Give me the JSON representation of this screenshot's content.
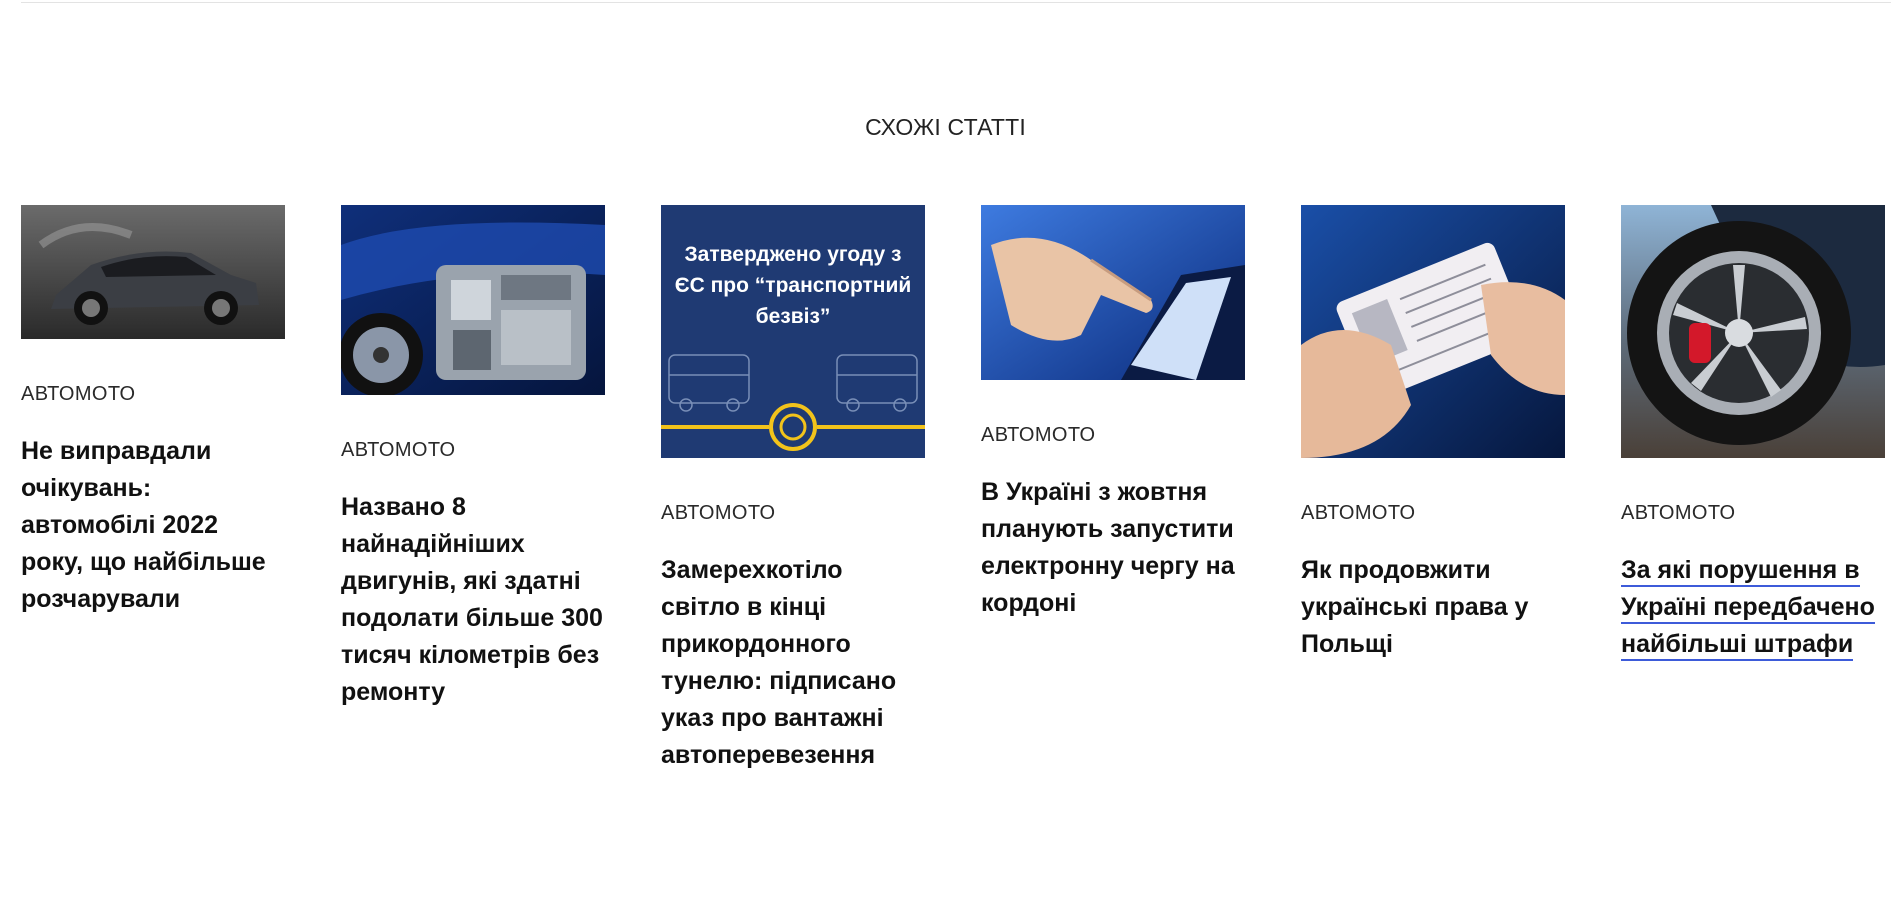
{
  "section": {
    "title": "СХОЖІ СТАТТІ"
  },
  "articles": [
    {
      "category": "АВТОМОТО",
      "title": "Не виправдали очікувань: автомобілі 2022 року, що найбільше розчарували",
      "image_icon": "car-photo-icon"
    },
    {
      "category": "АВТОМОТО",
      "title": "Названо 8 найнадійніших двигунів, які здатні подолати більше 300 тисяч кілометрів без ремонту",
      "image_icon": "engine-photo-icon"
    },
    {
      "category": "АВТОМОТО",
      "title": "Замерехкотіло світло в кінці прикордонного тунелю: підписано указ про вантажні автоперевезення",
      "image_icon": "transport-bezviz-banner-icon",
      "image_text_lines": [
        "Затверджено угоду з",
        "ЄС про “транспортний",
        "безвіз”"
      ]
    },
    {
      "category": "АВТОМОТО",
      "title": "В Україні з жовтня планують запустити електронну чергу на кордоні",
      "image_icon": "hand-tablet-photo-icon"
    },
    {
      "category": "АВТОМОТО",
      "title": "Як продовжити українські права у Польщі",
      "image_icon": "driver-license-photo-icon"
    },
    {
      "category": "АВТОМОТО",
      "title": "За які порушення в Україні передбачено найбільші штрафи",
      "image_icon": "car-wheel-photo-icon"
    }
  ],
  "colors": {
    "link_underline": "#3d5bd9",
    "banner_bg": "#1f3a73",
    "banner_accent": "#f2c31b"
  }
}
